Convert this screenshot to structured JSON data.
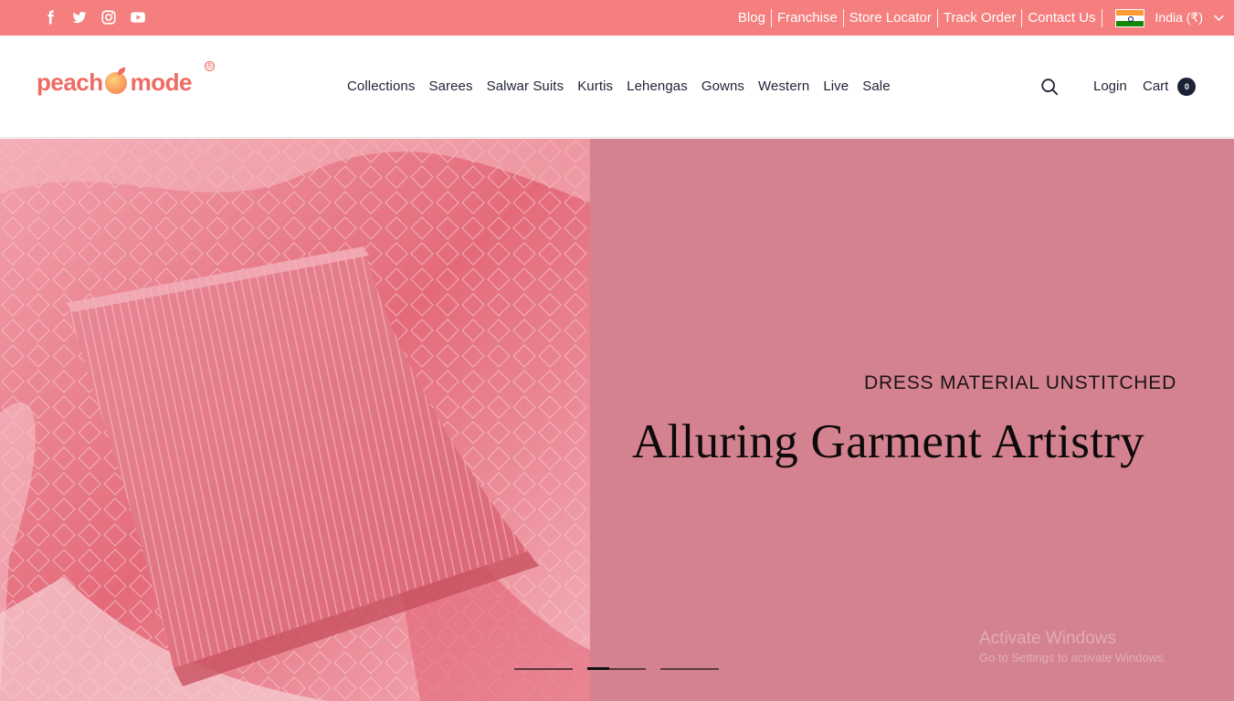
{
  "topbar": {
    "social": [
      "facebook-icon",
      "twitter-icon",
      "instagram-icon",
      "youtube-icon"
    ],
    "links": [
      "Blog",
      "Franchise",
      "Store Locator",
      "Track Order",
      "Contact Us"
    ],
    "country": "India (₹)"
  },
  "header": {
    "logo": {
      "left": "peach",
      "right": "mode"
    },
    "nav": [
      "Collections",
      "Sarees",
      "Salwar Suits",
      "Kurtis",
      "Lehengas",
      "Gowns",
      "Western",
      "Live",
      "Sale"
    ],
    "login": "Login",
    "cart": {
      "label": "Cart",
      "count": "0"
    }
  },
  "hero": {
    "subtitle": "DRESS MATERIAL UNSTITCHED",
    "title": "Alluring Garment Artistry",
    "slides": 3,
    "active_slide": 2
  },
  "watermark": {
    "line1": "Activate Windows",
    "line2": "Go to Settings to activate Windows."
  },
  "colors": {
    "topbar": "#f47f7e",
    "hero_bg": "#d4828f",
    "brand": "#ef6a63",
    "text": "#1e2235"
  }
}
